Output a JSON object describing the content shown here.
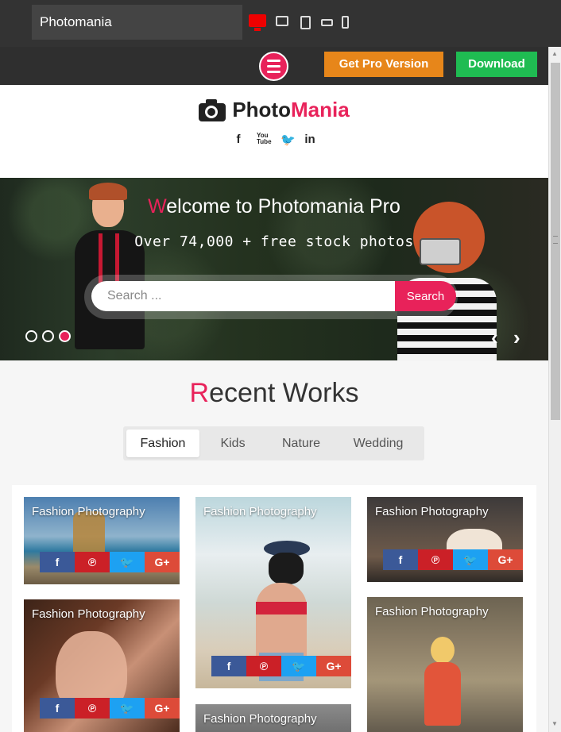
{
  "preview_bar": {
    "theme_name": "Photomania",
    "devices": [
      "desktop-icon",
      "tablet-landscape-icon",
      "tablet-portrait-icon",
      "phone-landscape-icon",
      "phone-portrait-icon"
    ],
    "get_pro_label": "Get Pro Version",
    "download_label": "Download"
  },
  "header": {
    "logo_part1": "Photo",
    "logo_part2": "Mania",
    "socials": [
      {
        "name": "facebook-icon",
        "glyph": "f"
      },
      {
        "name": "youtube-icon",
        "glyph": "You Tube"
      },
      {
        "name": "twitter-icon",
        "glyph": "🐦"
      },
      {
        "name": "linkedin-icon",
        "glyph": "in"
      }
    ]
  },
  "hero": {
    "title_first": "W",
    "title_rest": "elcome to Photomania Pro",
    "subtitle": "Over 74,000 + free stock photos",
    "search_placeholder": "Search ...",
    "search_button": "Search",
    "prev_arrow": "‹",
    "next_arrow": "›"
  },
  "recent_works": {
    "title_first": "R",
    "title_rest": "ecent Works",
    "tabs": [
      "Fashion",
      "Kids",
      "Nature",
      "Wedding"
    ]
  },
  "gallery": {
    "card_title": "Fashion Photography",
    "share": {
      "facebook": "f",
      "pinterest": "℗",
      "twitter": "🐦",
      "google_plus": "G+"
    }
  },
  "colors": {
    "accent": "#e8225a",
    "pro_button": "#e7861a",
    "download_button": "#1fbc52"
  }
}
